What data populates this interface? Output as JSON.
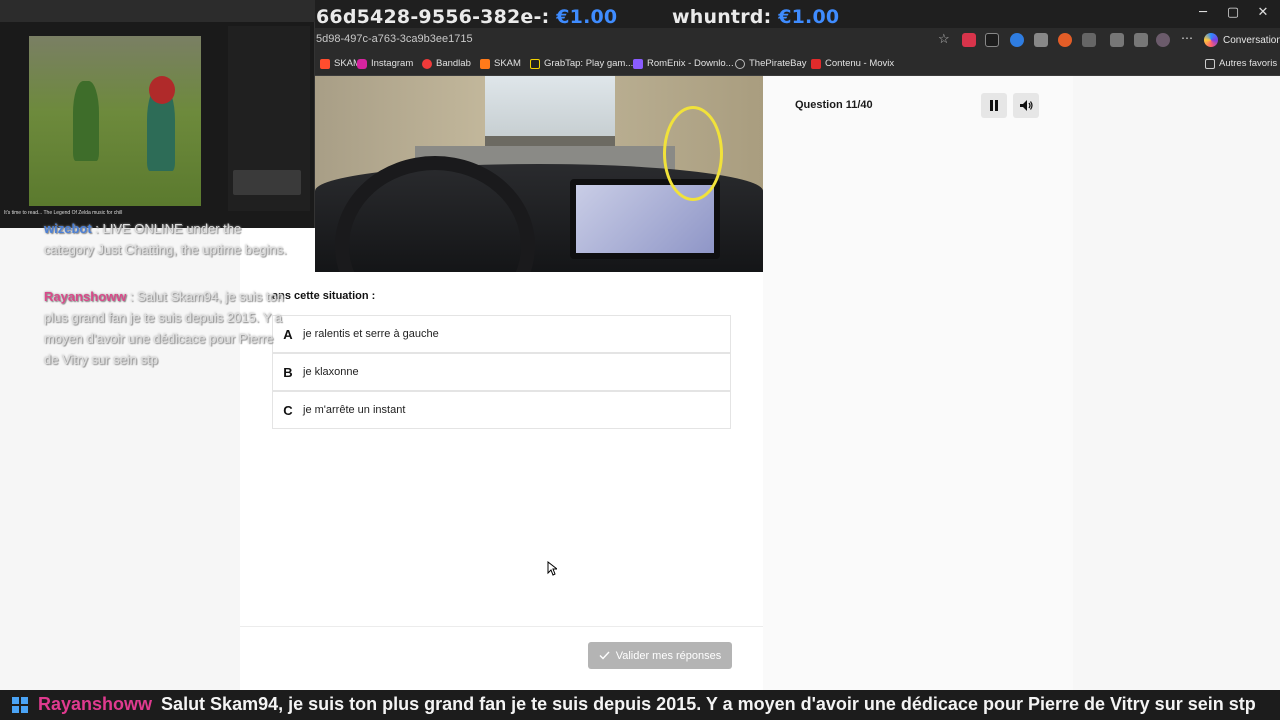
{
  "browser": {
    "donations": [
      {
        "id_text": "66d5428-9556-382e-:",
        "amount": "€1.00"
      },
      {
        "id_text": "whuntrd:",
        "amount": "€1.00"
      }
    ],
    "window_controls": {
      "minimize": "─",
      "maximize": "▢",
      "close": "✕"
    },
    "url": "5d98-497c-a763-3ca9b3ee1715",
    "conversation_label": "Conversation",
    "bookmarks": [
      {
        "label": "SKAM",
        "color": "#ff4d2e"
      },
      {
        "label": "Instagram",
        "color": "#d6249f"
      },
      {
        "label": "Bandlab",
        "color": "#f03a3a"
      },
      {
        "label": "SKAM",
        "color": "#ff7a1a"
      },
      {
        "label": "GrabTap: Play gam...",
        "color": "#f2d200"
      },
      {
        "label": "RomEnix - Downlo...",
        "color": "#8a5cff"
      },
      {
        "label": "ThePirateBay",
        "color": "#bbbbbb"
      },
      {
        "label": "Contenu - Movix",
        "color": "#e02b2b"
      }
    ],
    "other_bookmarks": "Autres favoris"
  },
  "quiz": {
    "question_counter": "Question 11/40",
    "prompt": "ans cette situation :",
    "answers": [
      {
        "letter": "A",
        "text": "je ralentis et serre à gauche"
      },
      {
        "letter": "B",
        "text": "je klaxonne"
      },
      {
        "letter": "C",
        "text": "je m'arrête un instant"
      }
    ],
    "validate_label": "Valider mes réponses",
    "pause_icon": "pause-icon",
    "volume_icon": "volume-icon"
  },
  "stream": {
    "webcam_caption": "It's time to read... The Legend Of Zelda music for chill",
    "chat": [
      {
        "user": "wizebot",
        "user_color": "#4a7fd6",
        "message": "LIVE ONLINE under the category Just Chatting, the uptime begins."
      },
      {
        "user": "Rayanshoww",
        "user_color": "#d94a8a",
        "message": "Salut Skam94, je suis ton plus grand fan je te suis depuis 2015. Y a moyen d'avoir une dédicace pour Pierre de Vitry sur sein stp"
      }
    ],
    "ticker": {
      "user": "Rayanshoww",
      "message": "Salut Skam94, je suis ton plus grand fan je te suis depuis 2015. Y a moyen d'avoir une dédicace pour Pierre de Vitry sur sein stp"
    }
  }
}
